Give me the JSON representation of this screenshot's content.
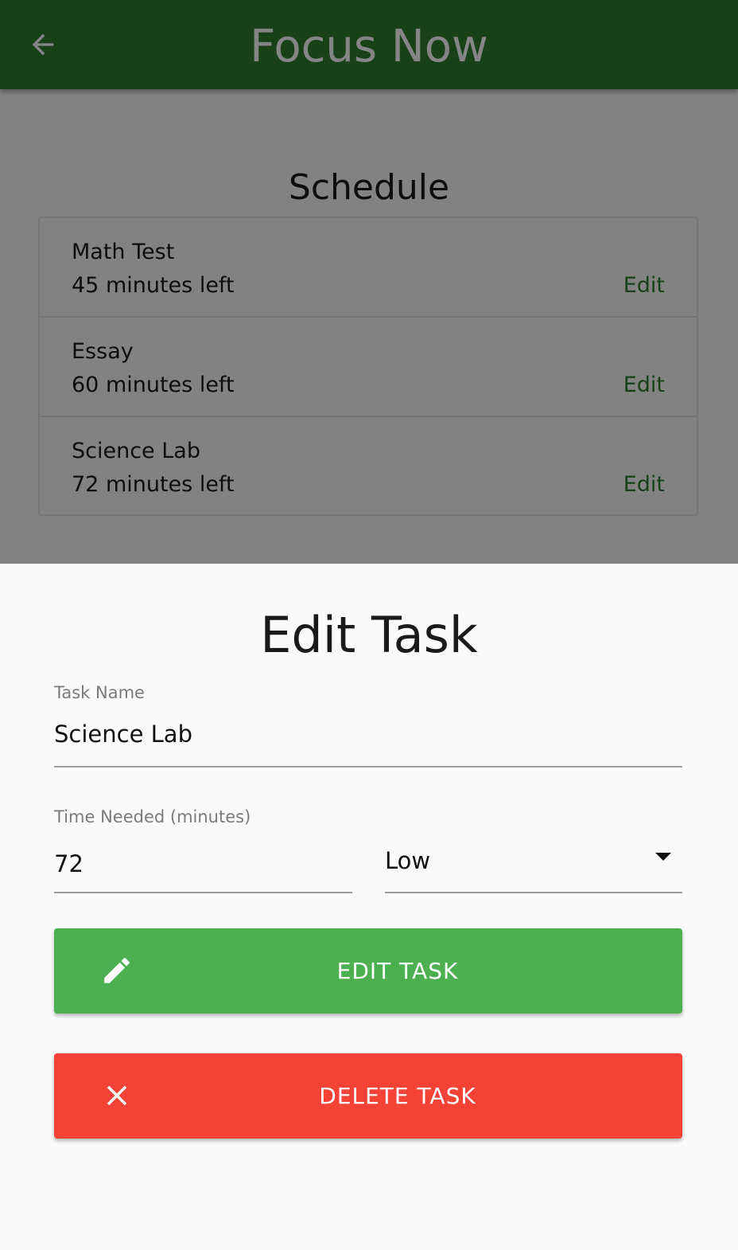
{
  "app": {
    "title": "Focus Now",
    "colors": {
      "primary": "#2e7d32",
      "edit_button": "#4caf50",
      "delete_button": "#f44336"
    }
  },
  "schedule": {
    "title": "Schedule",
    "tasks": [
      {
        "name": "Math Test",
        "time_left": "45 minutes left",
        "action": "Edit"
      },
      {
        "name": "Essay",
        "time_left": "60 minutes left",
        "action": "Edit"
      },
      {
        "name": "Science Lab",
        "time_left": "72 minutes left",
        "action": "Edit"
      }
    ]
  },
  "edit_sheet": {
    "title": "Edit Task",
    "task_name": {
      "label": "Task Name",
      "value": "Science Lab"
    },
    "time_needed": {
      "label": "Time Needed (minutes)",
      "value": "72"
    },
    "priority": {
      "selected": "Low"
    },
    "edit_button": {
      "label": "EDIT TASK",
      "icon": "pencil-icon"
    },
    "delete_button": {
      "label": "DELETE TASK",
      "icon": "close-icon"
    }
  }
}
